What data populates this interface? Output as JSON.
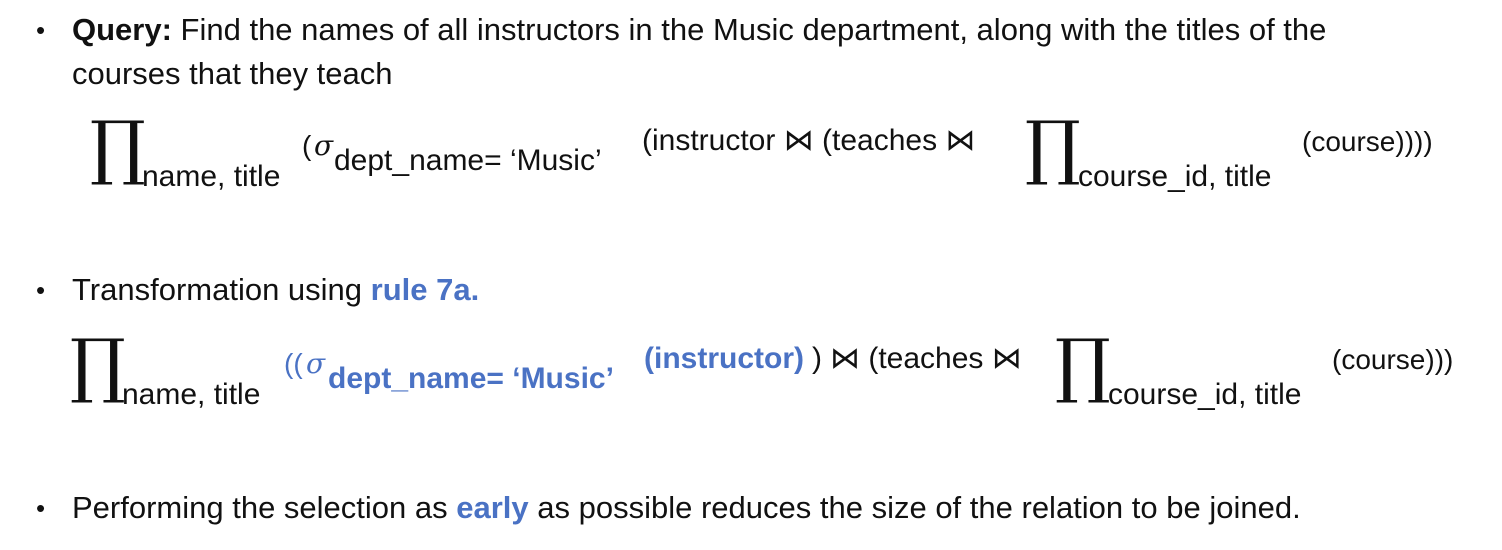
{
  "bullets": {
    "query_label": "Query:",
    "query_text": " Find the names of all instructors in the Music department, along with the titles of the",
    "query_text_2": "courses that they teach",
    "transform_prefix": "Transformation using ",
    "transform_rule": "rule 7a.",
    "perf_prefix": "Performing the selection as ",
    "perf_highlight": "early",
    "perf_suffix": " as possible reduces the size of the relation to be joined."
  },
  "expr1": {
    "pi": "∏",
    "proj_attrs": "name, title",
    "open_paren": "(",
    "sigma": "σ",
    "cond": "dept_name= ‘Music’",
    "body": "(instructor ⋈ (teaches ⋈",
    "pi2": "∏",
    "proj_attrs2": "course_id, title",
    "tail": "(course))))"
  },
  "expr2": {
    "pi": "∏",
    "proj_attrs": "name, title",
    "open_paren": "((",
    "sigma": "σ",
    "cond": "dept_name= ‘Music’",
    "arg": "(instructor)",
    "close": ")",
    "body": "⋈ (teaches ⋈",
    "pi2": "∏",
    "proj_attrs2": "course_id, title",
    "tail": "(course)))"
  }
}
